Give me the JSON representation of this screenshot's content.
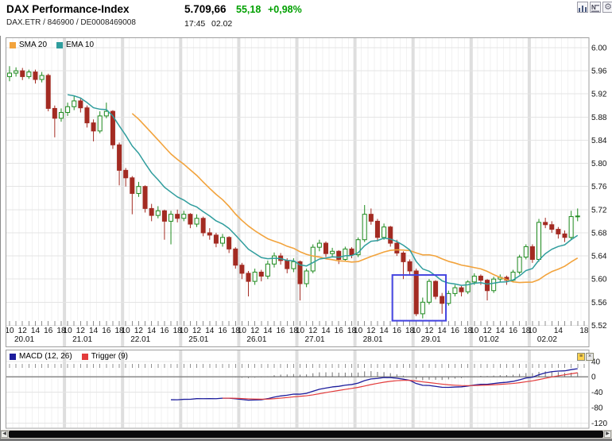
{
  "header": {
    "title": "DAX Performance-Index",
    "subtitle": "DAX.ETR / 846900 / DE0008469008",
    "last_price": "5.709,66",
    "change_abs": "55,18",
    "change_pct": "+0,98%",
    "time": "17:45",
    "date": "02.02",
    "up_color": "#00a000"
  },
  "toolbar": {
    "icons": [
      "bar-chart-icon",
      "news-icon",
      "settings-icon"
    ]
  },
  "legend": {
    "sma_label": "SMA 20",
    "ema_label": "EMA 10"
  },
  "macd_panel": {
    "macd_label": "MACD (12, 26)",
    "trigger_label": "Trigger (9)",
    "y_tick_labels": [
      "40",
      "0",
      "-40",
      "-80",
      "-120"
    ],
    "y_tick_values": [
      40,
      0,
      -40,
      -80,
      -120
    ],
    "close_glyph": "×",
    "properties_glyph": "≡"
  },
  "scrollbar": {
    "left_arrow": "◀",
    "right_arrow": "▶"
  },
  "chart_data": {
    "type": "candlestick",
    "title": "DAX Performance-Index, hourly candles with SMA 20, EMA 10 and MACD(12,26)/Trigger(9)",
    "days": [
      "20.01",
      "21.01",
      "22.01",
      "25.01",
      "26.01",
      "27.01",
      "28.01",
      "29.01",
      "01.02",
      "02.02"
    ],
    "candles_per_day": [
      9,
      9,
      9,
      9,
      9,
      9,
      9,
      9,
      9,
      8
    ],
    "hour_slots": [
      "10",
      "11",
      "12",
      "13",
      "14",
      "15",
      "16",
      "17",
      "18"
    ],
    "x_tick_slots": [
      0,
      2,
      4,
      6,
      8
    ],
    "x_tick_labels": [
      "10",
      "12",
      "14",
      "16",
      "18"
    ],
    "x_tick_slots_last_day": [
      0,
      4,
      8
    ],
    "x_tick_labels_last_day": [
      "10",
      "14",
      "18"
    ],
    "y_tick_labels": [
      "6.00",
      "5.96",
      "5.92",
      "5.88",
      "5.84",
      "5.80",
      "5.76",
      "5.72",
      "5.68",
      "5.64",
      "5.60",
      "5.56",
      "5.52"
    ],
    "y_tick_top_value": 6.0,
    "price_grid_step": 0.04,
    "ylim": [
      5.5,
      6.02
    ],
    "macd_ylim": [
      -130,
      45
    ],
    "indicators": {
      "sma_period": 20,
      "ema_period": 10,
      "macd_fast": 12,
      "macd_slow": 26,
      "macd_signal": 9
    },
    "annotation_box": {
      "bar_start": 59.3,
      "bar_end": 67.6,
      "price_top": 5.607,
      "price_bottom": 5.528,
      "color": "#4343e0"
    },
    "colors": {
      "up": "#1e8a1e",
      "down": "#a32b22",
      "sma": "#f2a33c",
      "ema": "#2f9d9d",
      "macd": "#1c1c9c",
      "trigger": "#e33b3b",
      "grid": "#e4e4e4",
      "day_grid": "#dedede",
      "hour_grid": "#f2f2f2",
      "axis_text": "#111111",
      "zero_line": "#8a8a8a",
      "hist": "#707070",
      "panel_border": "#9f9f9f",
      "tick": "#909090"
    },
    "ohlc": [
      [
        5.95,
        5.968,
        5.942,
        5.956
      ],
      [
        5.956,
        5.966,
        5.95,
        5.96
      ],
      [
        5.96,
        5.965,
        5.944,
        5.95
      ],
      [
        5.95,
        5.962,
        5.946,
        5.958
      ],
      [
        5.958,
        5.962,
        5.938,
        5.945
      ],
      [
        5.945,
        5.958,
        5.94,
        5.952
      ],
      [
        5.952,
        5.955,
        5.89,
        5.895
      ],
      [
        5.895,
        5.9,
        5.845,
        5.878
      ],
      [
        5.878,
        5.895,
        5.872,
        5.888
      ],
      [
        5.888,
        5.905,
        5.882,
        5.898
      ],
      [
        5.898,
        5.916,
        5.892,
        5.908
      ],
      [
        5.908,
        5.912,
        5.888,
        5.896
      ],
      [
        5.896,
        5.9,
        5.862,
        5.87
      ],
      [
        5.87,
        5.876,
        5.838,
        5.856
      ],
      [
        5.856,
        5.89,
        5.852,
        5.882
      ],
      [
        5.882,
        5.905,
        5.878,
        5.89
      ],
      [
        5.89,
        5.892,
        5.825,
        5.832
      ],
      [
        5.832,
        5.836,
        5.762,
        5.788
      ],
      [
        5.788,
        5.792,
        5.76,
        5.775
      ],
      [
        5.775,
        5.778,
        5.712,
        5.748
      ],
      [
        5.748,
        5.768,
        5.742,
        5.76
      ],
      [
        5.76,
        5.762,
        5.715,
        5.722
      ],
      [
        5.722,
        5.73,
        5.7,
        5.71
      ],
      [
        5.71,
        5.726,
        5.705,
        5.718
      ],
      [
        5.718,
        5.72,
        5.668,
        5.7
      ],
      [
        5.7,
        5.718,
        5.66,
        5.712
      ],
      [
        5.712,
        5.72,
        5.698,
        5.705
      ],
      [
        5.705,
        5.718,
        5.7,
        5.712
      ],
      [
        5.712,
        5.714,
        5.688,
        5.695
      ],
      [
        5.695,
        5.712,
        5.69,
        5.705
      ],
      [
        5.705,
        5.708,
        5.674,
        5.68
      ],
      [
        5.68,
        5.688,
        5.668,
        5.676
      ],
      [
        5.676,
        5.68,
        5.655,
        5.662
      ],
      [
        5.662,
        5.678,
        5.656,
        5.672
      ],
      [
        5.672,
        5.674,
        5.645,
        5.652
      ],
      [
        5.652,
        5.655,
        5.618,
        5.624
      ],
      [
        5.624,
        5.628,
        5.6,
        5.61
      ],
      [
        5.61,
        5.614,
        5.57,
        5.596
      ],
      [
        5.596,
        5.618,
        5.59,
        5.612
      ],
      [
        5.612,
        5.616,
        5.596,
        5.605
      ],
      [
        5.605,
        5.632,
        5.6,
        5.626
      ],
      [
        5.626,
        5.646,
        5.62,
        5.64
      ],
      [
        5.64,
        5.645,
        5.625,
        5.632
      ],
      [
        5.632,
        5.636,
        5.61,
        5.618
      ],
      [
        5.618,
        5.636,
        5.612,
        5.63
      ],
      [
        5.63,
        5.632,
        5.563,
        5.592
      ],
      [
        5.592,
        5.618,
        5.586,
        5.614
      ],
      [
        5.614,
        5.66,
        5.61,
        5.655
      ],
      [
        5.655,
        5.668,
        5.648,
        5.662
      ],
      [
        5.662,
        5.665,
        5.638,
        5.644
      ],
      [
        5.644,
        5.654,
        5.638,
        5.648
      ],
      [
        5.648,
        5.65,
        5.626,
        5.634
      ],
      [
        5.634,
        5.656,
        5.63,
        5.652
      ],
      [
        5.652,
        5.655,
        5.636,
        5.642
      ],
      [
        5.642,
        5.672,
        5.638,
        5.668
      ],
      [
        5.668,
        5.728,
        5.664,
        5.712
      ],
      [
        5.712,
        5.722,
        5.694,
        5.7
      ],
      [
        5.7,
        5.704,
        5.665,
        5.672
      ],
      [
        5.672,
        5.696,
        5.668,
        5.69
      ],
      [
        5.69,
        5.692,
        5.656,
        5.662
      ],
      [
        5.662,
        5.668,
        5.64,
        5.645
      ],
      [
        5.645,
        5.648,
        5.6,
        5.63
      ],
      [
        5.63,
        5.634,
        5.608,
        5.614
      ],
      [
        5.614,
        5.618,
        5.536,
        5.54
      ],
      [
        5.54,
        5.568,
        5.532,
        5.56
      ],
      [
        5.56,
        5.6,
        5.556,
        5.596
      ],
      [
        5.596,
        5.598,
        5.565,
        5.57
      ],
      [
        5.57,
        5.576,
        5.54,
        5.558
      ],
      [
        5.558,
        5.58,
        5.554,
        5.575
      ],
      [
        5.575,
        5.59,
        5.57,
        5.585
      ],
      [
        5.585,
        5.588,
        5.57,
        5.578
      ],
      [
        5.578,
        5.598,
        5.574,
        5.595
      ],
      [
        5.595,
        5.61,
        5.59,
        5.605
      ],
      [
        5.605,
        5.608,
        5.59,
        5.598
      ],
      [
        5.598,
        5.6,
        5.563,
        5.58
      ],
      [
        5.58,
        5.604,
        5.576,
        5.6
      ],
      [
        5.6,
        5.608,
        5.595,
        5.603
      ],
      [
        5.603,
        5.606,
        5.59,
        5.598
      ],
      [
        5.598,
        5.616,
        5.594,
        5.612
      ],
      [
        5.612,
        5.642,
        5.608,
        5.638
      ],
      [
        5.638,
        5.66,
        5.634,
        5.656
      ],
      [
        5.656,
        5.66,
        5.628,
        5.634
      ],
      [
        5.634,
        5.704,
        5.63,
        5.698
      ],
      [
        5.698,
        5.706,
        5.688,
        5.694
      ],
      [
        5.694,
        5.7,
        5.68,
        5.686
      ],
      [
        5.686,
        5.69,
        5.67,
        5.678
      ],
      [
        5.678,
        5.684,
        5.664,
        5.672
      ],
      [
        5.672,
        5.718,
        5.668,
        5.708
      ],
      [
        5.708,
        5.722,
        5.7,
        5.709
      ]
    ]
  }
}
